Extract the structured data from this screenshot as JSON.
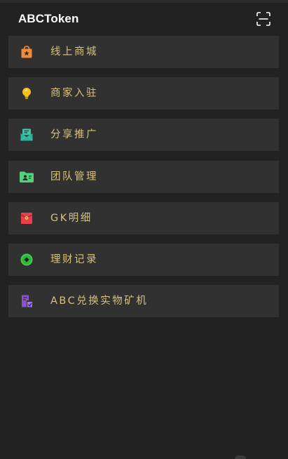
{
  "header": {
    "title": "ABCToken",
    "scan_icon": "scan-icon"
  },
  "menu": {
    "items": [
      {
        "label": "线上商城",
        "icon": "shopping-bag-icon",
        "color": "#f08a3c"
      },
      {
        "label": "商家入驻",
        "icon": "lightbulb-icon",
        "color": "#f5c21b"
      },
      {
        "label": "分享推广",
        "icon": "share-envelope-icon",
        "color": "#35c9b0"
      },
      {
        "label": "团队管理",
        "icon": "team-folder-icon",
        "color": "#4fd37a"
      },
      {
        "label": "GK明细",
        "icon": "red-envelope-icon",
        "color": "#e8404a"
      },
      {
        "label": "理财记录",
        "icon": "coin-icon",
        "color": "#3fcf4a"
      },
      {
        "label": "ABC兑换实物矿机",
        "icon": "exchange-document-icon",
        "color": "#8d4fd6"
      }
    ]
  }
}
